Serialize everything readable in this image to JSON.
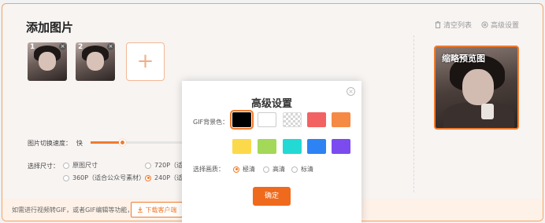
{
  "header": {
    "title": "添加图片",
    "clear_list": "清空列表",
    "advanced_settings": "高级设置"
  },
  "images": [
    {
      "number": "1"
    },
    {
      "number": "2"
    }
  ],
  "add_image": {
    "label": "+"
  },
  "preview": {
    "label": "缩略预览图"
  },
  "speed": {
    "label": "图片切换速度：",
    "value_text": "快",
    "value_fraction": 0.33
  },
  "size": {
    "label": "选择尺寸：",
    "options": [
      {
        "label": "原图尺寸",
        "selected": false
      },
      {
        "label": "720P（适合",
        "selected": false
      },
      {
        "label": "360P（适合公众号素材）",
        "selected": false
      },
      {
        "label": "240P（适合",
        "selected": true
      }
    ]
  },
  "bottom_bar": {
    "tip": "如需进行视频转GIF，或者GIF编辑等功能，请",
    "download_label": "下载客户端"
  },
  "modal": {
    "title": "高级设置",
    "bg_label": "GIF背景色：",
    "swatches": [
      {
        "name": "black",
        "color": "#000000",
        "selected": true
      },
      {
        "name": "white",
        "color": "#ffffff",
        "selected": false
      },
      {
        "name": "transparent",
        "color": "transparent",
        "selected": false
      },
      {
        "name": "coral",
        "color": "#f26262",
        "selected": false
      },
      {
        "name": "orange",
        "color": "#f58a45",
        "selected": false
      },
      {
        "name": "yellow",
        "color": "#fbd94a",
        "selected": false
      },
      {
        "name": "green",
        "color": "#a3d858",
        "selected": false
      },
      {
        "name": "cyan",
        "color": "#22d9d4",
        "selected": false
      },
      {
        "name": "blue",
        "color": "#2d83f3",
        "selected": false
      },
      {
        "name": "purple",
        "color": "#7b4bf0",
        "selected": false
      }
    ],
    "quality_label": "选择画质：",
    "quality_options": [
      {
        "label": "極清",
        "selected": true
      },
      {
        "label": "高清",
        "selected": false
      },
      {
        "label": "标清",
        "selected": false
      }
    ],
    "confirm_label": "确定"
  },
  "colors": {
    "accent": "#f07b2e",
    "confirm": "#f06a1d"
  }
}
